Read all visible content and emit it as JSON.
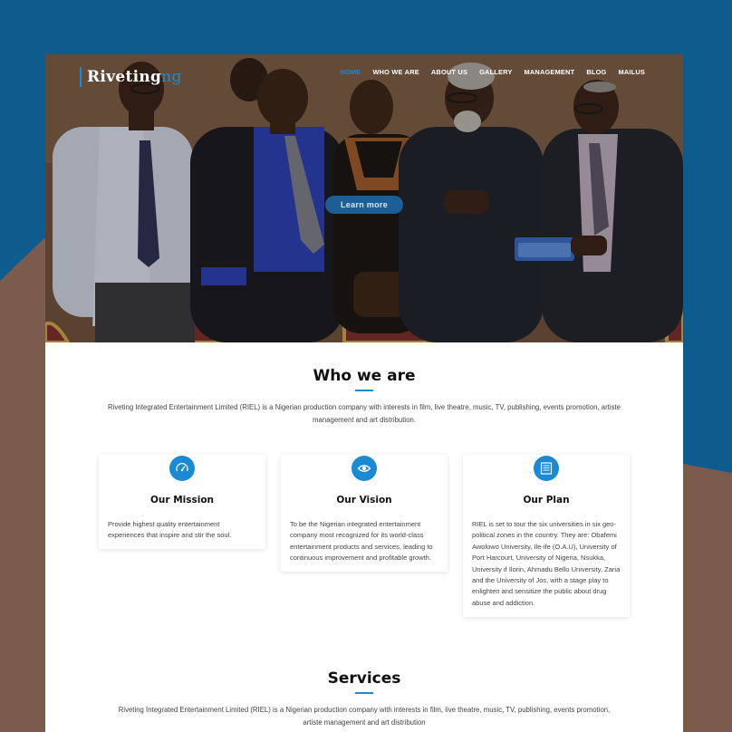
{
  "brand": {
    "name": "Riveting",
    "suffix": "ng"
  },
  "nav": {
    "items": [
      "HOME",
      "WHO WE ARE",
      "ABOUT US",
      "GALLERY",
      "MANAGEMENT",
      "BLOG",
      "MAILUS"
    ],
    "active_index": 0
  },
  "hero": {
    "cta_label": "Learn more"
  },
  "who_we_are": {
    "title": "Who we are",
    "intro_line1": "Riveting Integrated Entertainment Limited (RIEL) is a Nigerian production company with interests in film, live theatre, music, TV, publishing, events promotion, artiste",
    "intro_line2": "management and art distribution.",
    "cards": [
      {
        "title": "Our Mission",
        "icon": "gauge-icon",
        "text": "Provide highest quality entertainment experiences that inspire and stir the soul."
      },
      {
        "title": "Our Vision",
        "icon": "eye-icon",
        "text": "To be the Nigerian integrated entertainment company most recognized for its world-class entertainment products and services, leading to continuous improvement and profitable growth."
      },
      {
        "title": "Our Plan",
        "icon": "document-list-icon",
        "text": "RIEL is set to tour the six universities in six geo-political zones in the country. They are: Obafemi Awolowo University, Ile-ife (O.A.U), University of Port Harcourt, University of Nigeria, Nsukka, University if Ilorin, Ahmadu Bello University, Zaria and the University of Jos, with a stage play to enlighten and sensitize the public about drug abuse and addiction."
      }
    ]
  },
  "services": {
    "title": "Services",
    "intro_line1": "Riveting Integrated Entertainment Limited (RIEL) is a Nigerian production company with interests in film, live theatre, music, TV, publishing, events promotion,",
    "intro_line2": "artiste management and art distribution"
  },
  "colors": {
    "accent": "#1a8ad4",
    "background_blue": "#0e5c8e",
    "background_brown": "#7b5c4c",
    "cta": "#1b5f96"
  }
}
